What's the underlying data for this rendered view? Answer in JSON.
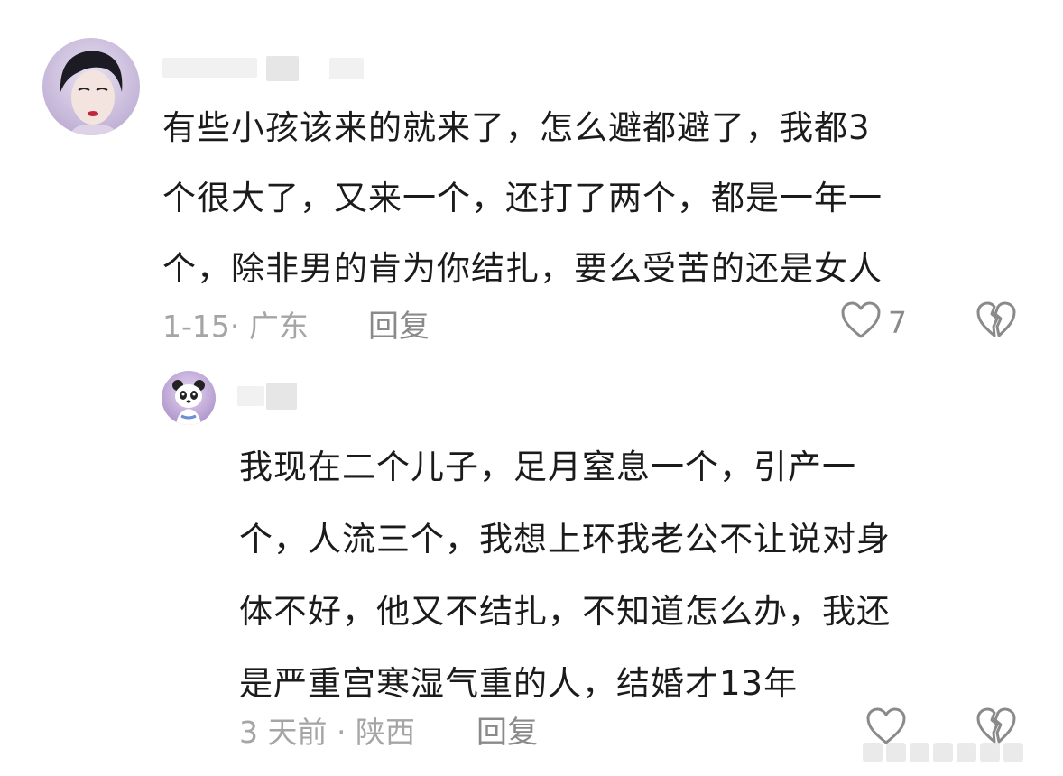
{
  "comments": [
    {
      "text": "有些小孩该来的就来了，怎么避都避了，我都3\n个很大了，又来一个，还打了两个，都是一年一\n个，除非男的肯为你结扎，要么受苦的还是女人",
      "meta": "1-15· 广东",
      "reply_label": "回复",
      "like_count": "7",
      "like_icon": "heart-outline-icon",
      "dislike_icon": "broken-heart-icon"
    },
    {
      "text": "我现在二个儿子，足月窒息一个，引产一\n个，人流三个，我想上环我老公不让说对身\n体不好，他又不结扎，不知道怎么办，我还\n是严重宫寒湿气重的人，结婚才13年",
      "meta": "3 天前 · 陕西",
      "reply_label": "回复",
      "like_count": "",
      "like_icon": "heart-outline-icon",
      "dislike_icon": "broken-heart-icon"
    }
  ],
  "colors": {
    "text": "#1b1b1b",
    "meta": "#a5a5a5",
    "action": "#8a8a8a",
    "background": "#ffffff"
  }
}
